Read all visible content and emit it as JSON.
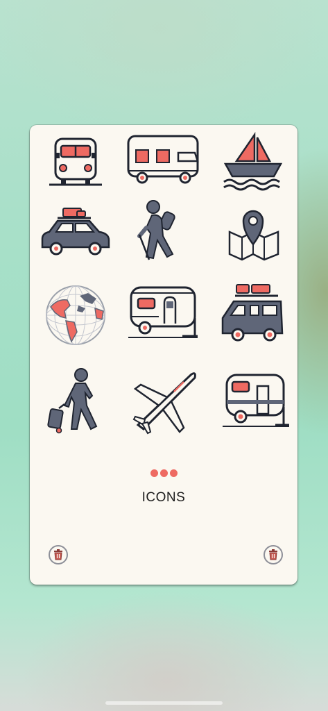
{
  "gallery": {
    "label": "ICONS",
    "page_indicator_count": 3
  },
  "icons": [
    "bus-front-icon",
    "camper-van-icon",
    "sailboat-icon",
    "car-with-luggage-icon",
    "hiker-icon",
    "map-pin-icon",
    "globe-icon",
    "travel-trailer-icon",
    "van-with-roof-rack-icon",
    "traveler-with-suitcase-icon",
    "airplane-icon",
    "caravan-icon"
  ],
  "colors": {
    "accent": "#ee6a62",
    "icon_fill": "#5f6678",
    "outline": "#1f2430",
    "card_background": "#fbf8f1"
  }
}
